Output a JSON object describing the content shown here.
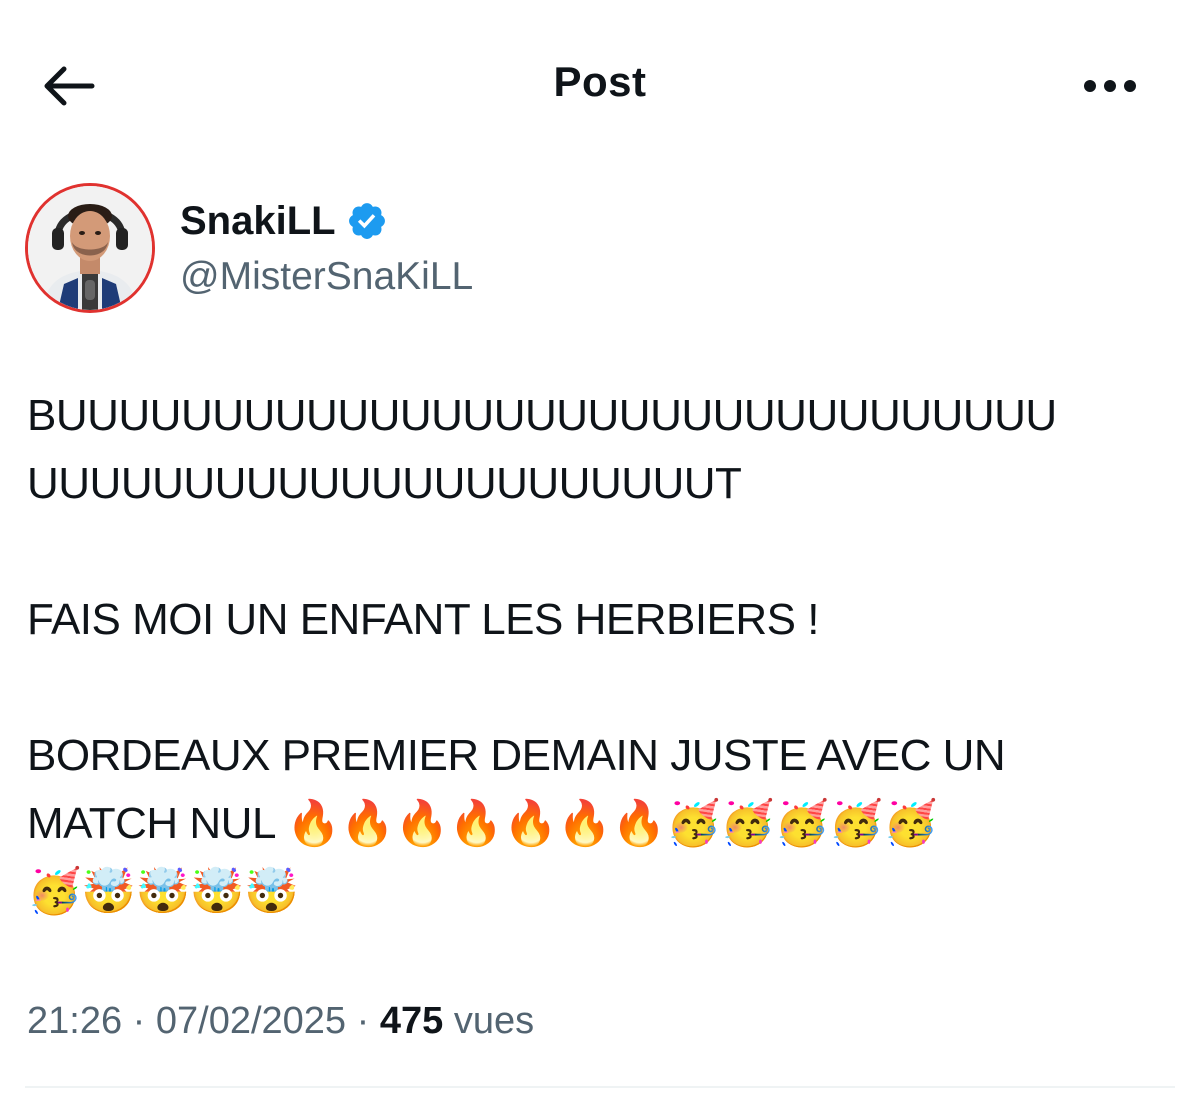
{
  "header": {
    "title": "Post",
    "back_icon": "arrow-left-icon",
    "more_icon": "more-horizontal-icon"
  },
  "author": {
    "display_name": "SnakiLL",
    "handle": "@MisterSnaKiLL",
    "verified": true,
    "verified_color": "#1d9bf0",
    "avatar_border_color": "#e0322f"
  },
  "tweet": {
    "line1": "BUUUUUUUUUUUUUUUUUUUUUUUUUUUUUUUU",
    "line2": "UUUUUUUUUUUUUUUUUUUUUUT",
    "line3": "FAIS MOI UN ENFANT LES HERBIERS !",
    "line4": "BORDEAUX PREMIER DEMAIN JUSTE AVEC UN",
    "line5": "MATCH NUL 🔥🔥🔥🔥🔥🔥🔥🥳🥳🥳🥳🥳",
    "line6": "🥳🤯🤯🤯🤯"
  },
  "meta": {
    "time": "21:26",
    "separator": "·",
    "date": "07/02/2025",
    "views_count": "475",
    "views_label": "vues"
  },
  "colors": {
    "text_primary": "#0f1419",
    "text_secondary": "#536471",
    "divider": "#eff3f4"
  }
}
